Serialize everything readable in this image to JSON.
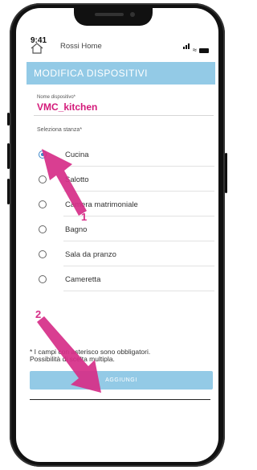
{
  "status": {
    "time": "9:41"
  },
  "header": {
    "app_title": "Rossi Home"
  },
  "section": {
    "title": "MODIFICA DISPOSITIVI"
  },
  "device": {
    "name_label": "Nome dispositivo*",
    "name_value": "VMC_kitchen"
  },
  "rooms": {
    "label": "Seleziona stanza*",
    "selected": "Cucina",
    "items": [
      {
        "label": "Cucina"
      },
      {
        "label": "Salotto"
      },
      {
        "label": "Camera matrimoniale"
      },
      {
        "label": "Bagno"
      },
      {
        "label": "Sala da pranzo"
      },
      {
        "label": "Cameretta"
      }
    ]
  },
  "footnote": {
    "line1": "* I campi con asterisco sono obbligatori.",
    "line2": "Possibilità di scelta multipla."
  },
  "actions": {
    "add_label": "AGGIUNGI"
  },
  "annotations": {
    "step1": "1",
    "step2": "2",
    "color": "#d62e88"
  },
  "icons": {
    "home": "home-icon",
    "signal": "signal-icon",
    "wifi": "wifi-icon",
    "battery": "battery-icon"
  },
  "colors": {
    "accent_bar": "#93cae6",
    "device_name": "#d41a7a",
    "radio_selected": "#3c86c8"
  }
}
